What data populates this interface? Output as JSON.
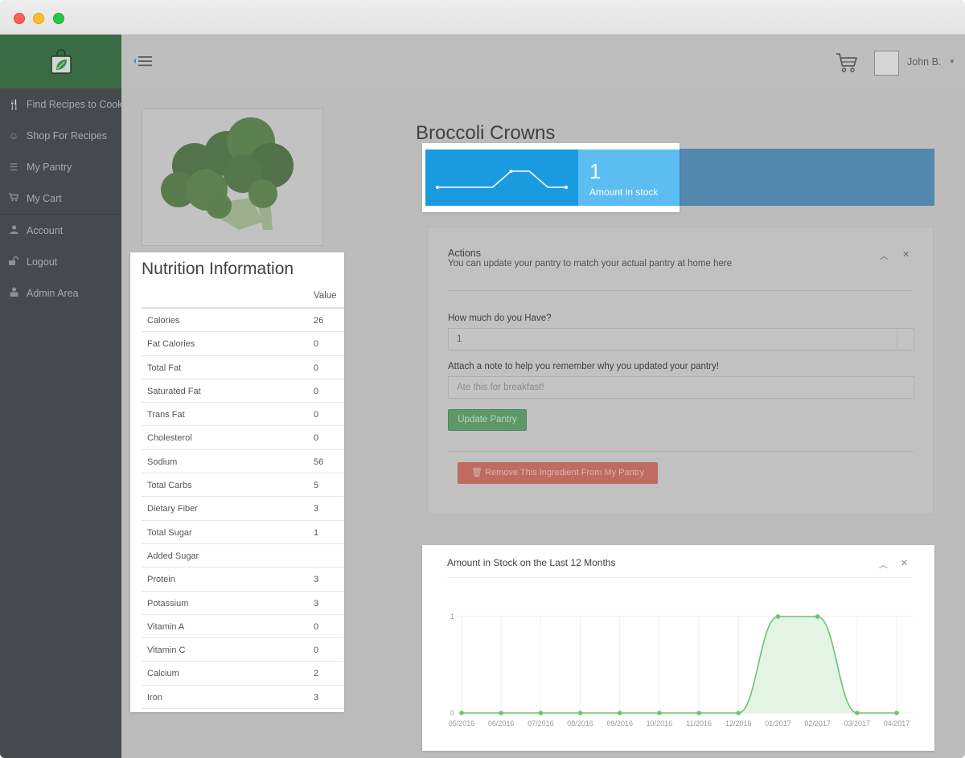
{
  "sidebar": {
    "logo_icon": "shopping-bag-leaf-icon",
    "items": [
      {
        "label": "Find Recipes to Cook",
        "icon": "utensils-icon"
      },
      {
        "label": "Shop For Recipes",
        "icon": "smile-icon"
      },
      {
        "label": "My Pantry",
        "icon": "list-icon"
      },
      {
        "label": "My Cart",
        "icon": "cart-icon"
      },
      {
        "label": "Account",
        "icon": "user-icon"
      },
      {
        "label": "Logout",
        "icon": "unlock-icon"
      },
      {
        "label": "Admin Area",
        "icon": "admin-icon"
      }
    ]
  },
  "header": {
    "user_name": "John B."
  },
  "product": {
    "title": "Broccoli Crowns",
    "stock_amount": "1",
    "stock_label": "Amount in stock"
  },
  "nutrition": {
    "title": "Nutrition Information",
    "value_header": "Value",
    "rows": [
      {
        "name": "Calories",
        "value": "26"
      },
      {
        "name": "Fat Calories",
        "value": "0"
      },
      {
        "name": "Total Fat",
        "value": "0"
      },
      {
        "name": "Saturated Fat",
        "value": "0"
      },
      {
        "name": "Trans Fat",
        "value": "0"
      },
      {
        "name": "Cholesterol",
        "value": "0"
      },
      {
        "name": "Sodium",
        "value": "56"
      },
      {
        "name": "Total Carbs",
        "value": "5"
      },
      {
        "name": "Dietary Fiber",
        "value": "3"
      },
      {
        "name": "Total Sugar",
        "value": "1"
      },
      {
        "name": "Added Sugar",
        "value": ""
      },
      {
        "name": "Protein",
        "value": "3"
      },
      {
        "name": "Potassium",
        "value": "3"
      },
      {
        "name": "Vitamin A",
        "value": "0"
      },
      {
        "name": "Vitamin C",
        "value": "0"
      },
      {
        "name": "Calcium",
        "value": "2"
      },
      {
        "name": "Iron",
        "value": "3"
      }
    ]
  },
  "actions": {
    "title": "Actions",
    "subtitle": "You can update your pantry to match your actual pantry at home here",
    "amount_label": "How much do you Have?",
    "amount_value": "1",
    "note_label": "Attach a note to help you remember why you updated your pantry!",
    "note_placeholder": "Ate this for breakfast!",
    "update_button": "Update Pantry",
    "remove_button": "Remove This Ingredient From My Pantry"
  },
  "colors": {
    "sidebar_bg": "#46494d",
    "logo_bg": "#3a6b44",
    "stock_dark": "#1a9be0",
    "stock_light": "#5cbdf2",
    "chart_line": "#6cc270",
    "chart_fill": "#e3f3e4",
    "update_button": "#5f9868",
    "remove_button": "#bf6b62"
  },
  "chart_data": {
    "type": "area",
    "title": "Amount in Stock on the Last 12 Months",
    "x": [
      "05/2016",
      "06/2016",
      "07/2016",
      "08/2016",
      "09/2016",
      "10/2016",
      "11/2016",
      "12/2016",
      "01/2017",
      "02/2017",
      "03/2017",
      "04/2017"
    ],
    "values": [
      0,
      0,
      0,
      0,
      0,
      0,
      0,
      0,
      1,
      1,
      0,
      0
    ],
    "y_ticks": [
      "0",
      "1"
    ],
    "ylim": [
      0,
      1
    ],
    "grid": true,
    "sparkline_values": [
      0,
      0,
      0,
      0,
      1,
      1,
      0,
      0
    ]
  }
}
